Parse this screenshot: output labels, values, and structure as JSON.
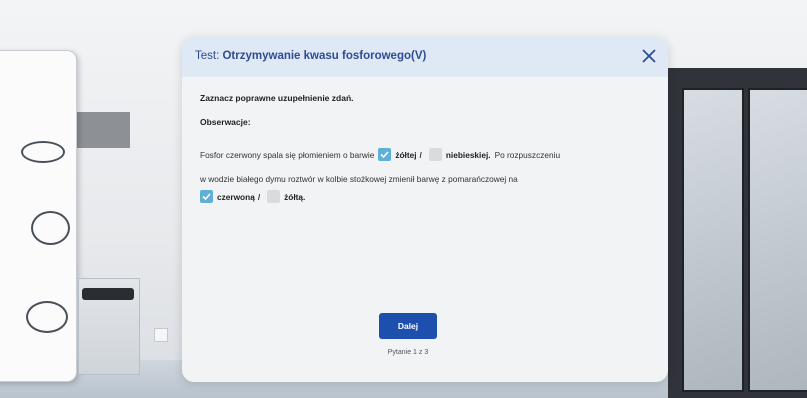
{
  "dialog": {
    "title_prefix": "Test: ",
    "title_name": "Otrzymywanie kwasu fosforowego(V)",
    "instruction": "Zaznacz poprawne uzupełnienie zdań.",
    "observations_label": "Obserwacje:",
    "sentence": {
      "part1": "Fosfor czerwony spala się płomieniem o barwie",
      "opt1_a": "żółtej",
      "opt1_a_checked": true,
      "opt1_b": "niebieskiej.",
      "opt1_b_checked": false,
      "part2": "Po rozpuszczeniu",
      "part3": "w wodzie białego dymu roztwór w kolbie stożkowej zmienił barwę z pomarańczowej na",
      "opt2_a": "czerwoną",
      "opt2_a_checked": true,
      "opt2_b": "żółtą.",
      "opt2_b_checked": false
    },
    "next_label": "Dalej",
    "question_counter": "Pytanie 1 z 3"
  },
  "colors": {
    "header_bg": "#dfe9f5",
    "title": "#2f4b94",
    "button": "#1d4fae",
    "checked": "#5fb0d8",
    "unchecked": "#d9dcdf"
  },
  "icons": [
    "close-icon",
    "check-icon"
  ]
}
